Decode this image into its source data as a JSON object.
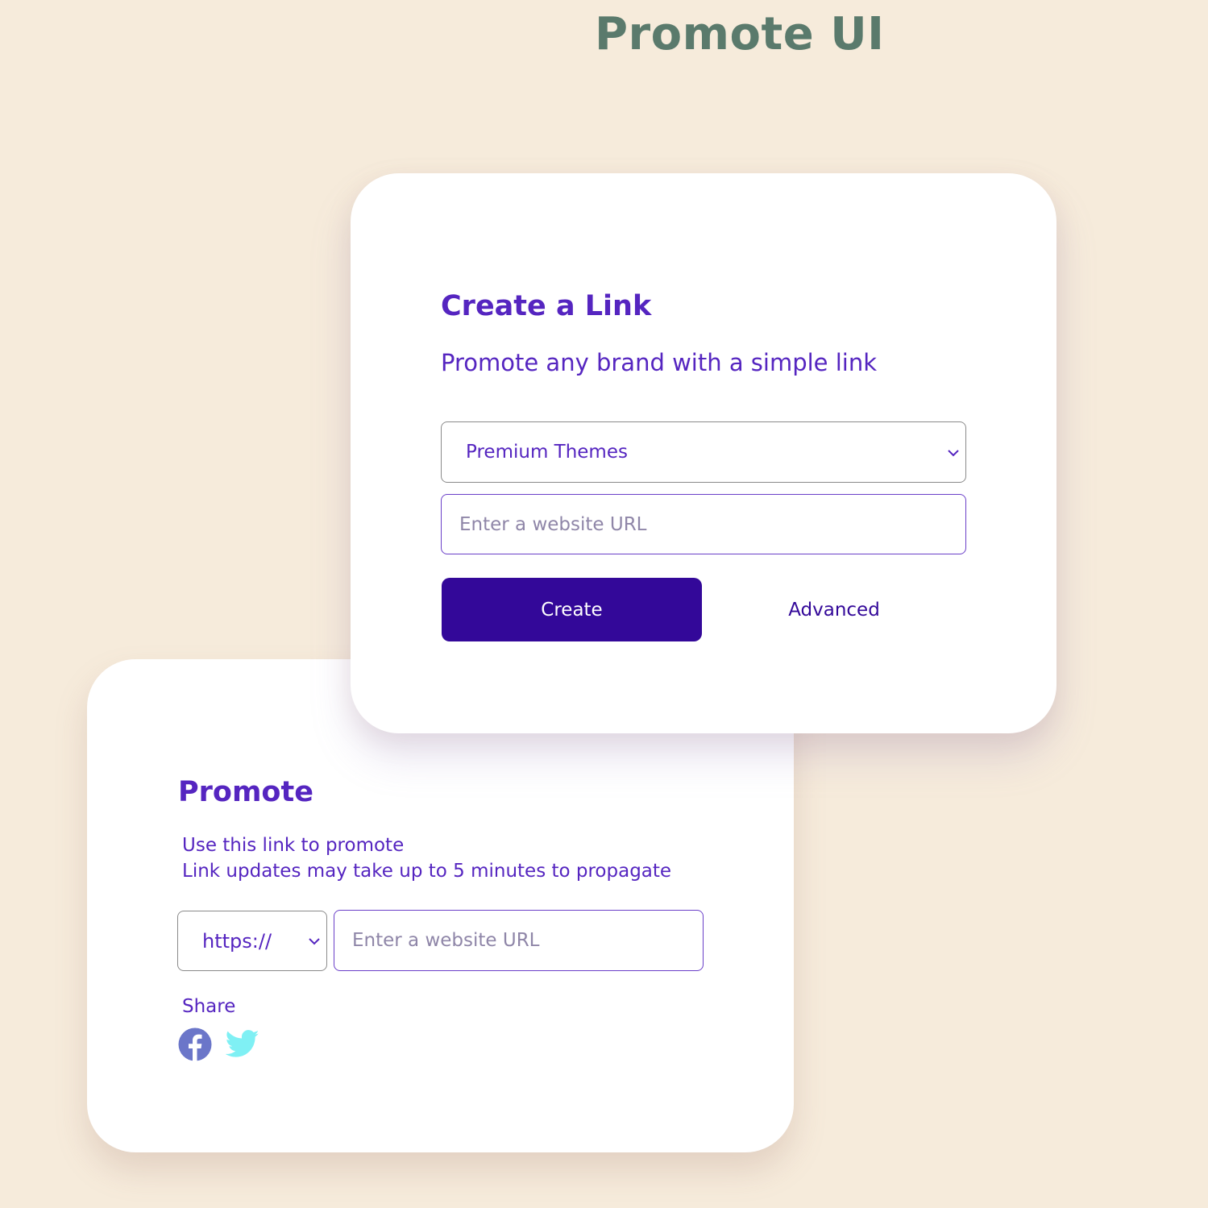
{
  "page": {
    "title": "Promote UI"
  },
  "create_card": {
    "heading": "Create a Link",
    "subheading": "Promote any brand with a simple link",
    "theme_select": {
      "selected": "Premium Themes"
    },
    "url_input": {
      "placeholder": "Enter a website URL",
      "value": ""
    },
    "create_button": "Create",
    "advanced_link": "Advanced"
  },
  "promote_card": {
    "heading": "Promote",
    "description_line1": "Use this link to promote",
    "description_line2": "Link updates may take up to 5 minutes to propagate",
    "protocol_select": {
      "selected": "https://"
    },
    "url_input": {
      "placeholder": "Enter a website URL",
      "value": ""
    },
    "share_label": "Share",
    "share_icons": [
      "facebook-icon",
      "twitter-icon"
    ]
  },
  "colors": {
    "background": "#f6ebdb",
    "title": "#5a7a6c",
    "accent": "#5525c0",
    "button": "#330899",
    "facebook": "#6b76c9",
    "twitter": "#7ff0f4"
  }
}
